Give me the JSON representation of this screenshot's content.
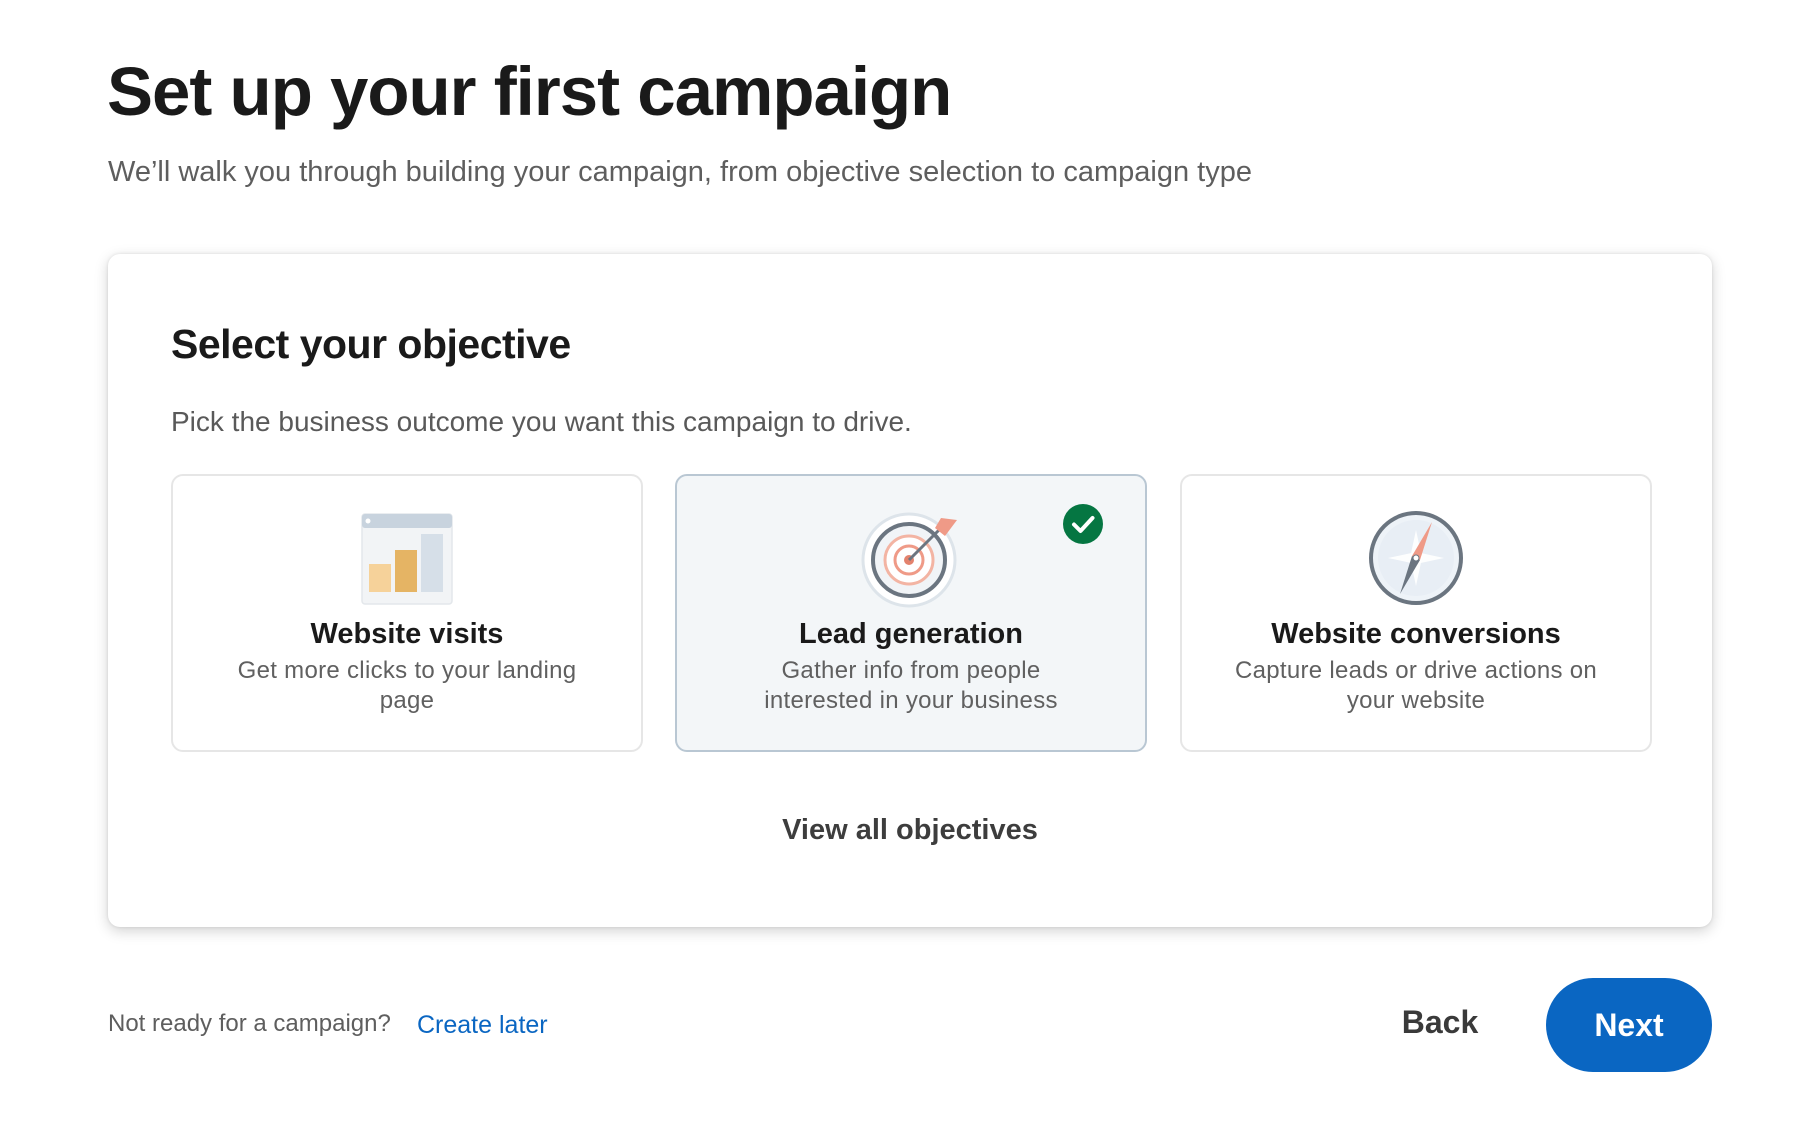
{
  "header": {
    "title": "Set up your first campaign",
    "subtitle": "We’ll walk you through building your campaign, from objective selection to campaign type"
  },
  "objective_card": {
    "title": "Select your objective",
    "description": "Pick the business outcome you want this campaign to drive.",
    "options": [
      {
        "label": "Website visits",
        "description": "Get more clicks to your landing page",
        "icon": "bar-chart-icon",
        "selected": false
      },
      {
        "label": "Lead generation",
        "description": "Gather info from people interested in your business",
        "icon": "target-icon",
        "selected": true
      },
      {
        "label": "Website conversions",
        "description": "Capture leads or drive actions on your website",
        "icon": "compass-icon",
        "selected": false
      }
    ],
    "view_all_label": "View all objectives"
  },
  "footer": {
    "note": "Not ready for a campaign?",
    "create_later_label": "Create later",
    "back_label": "Back",
    "next_label": "Next"
  },
  "colors": {
    "accent": "#0a66c2",
    "selected_check": "#057642",
    "selected_bg": "#f3f6f8"
  }
}
